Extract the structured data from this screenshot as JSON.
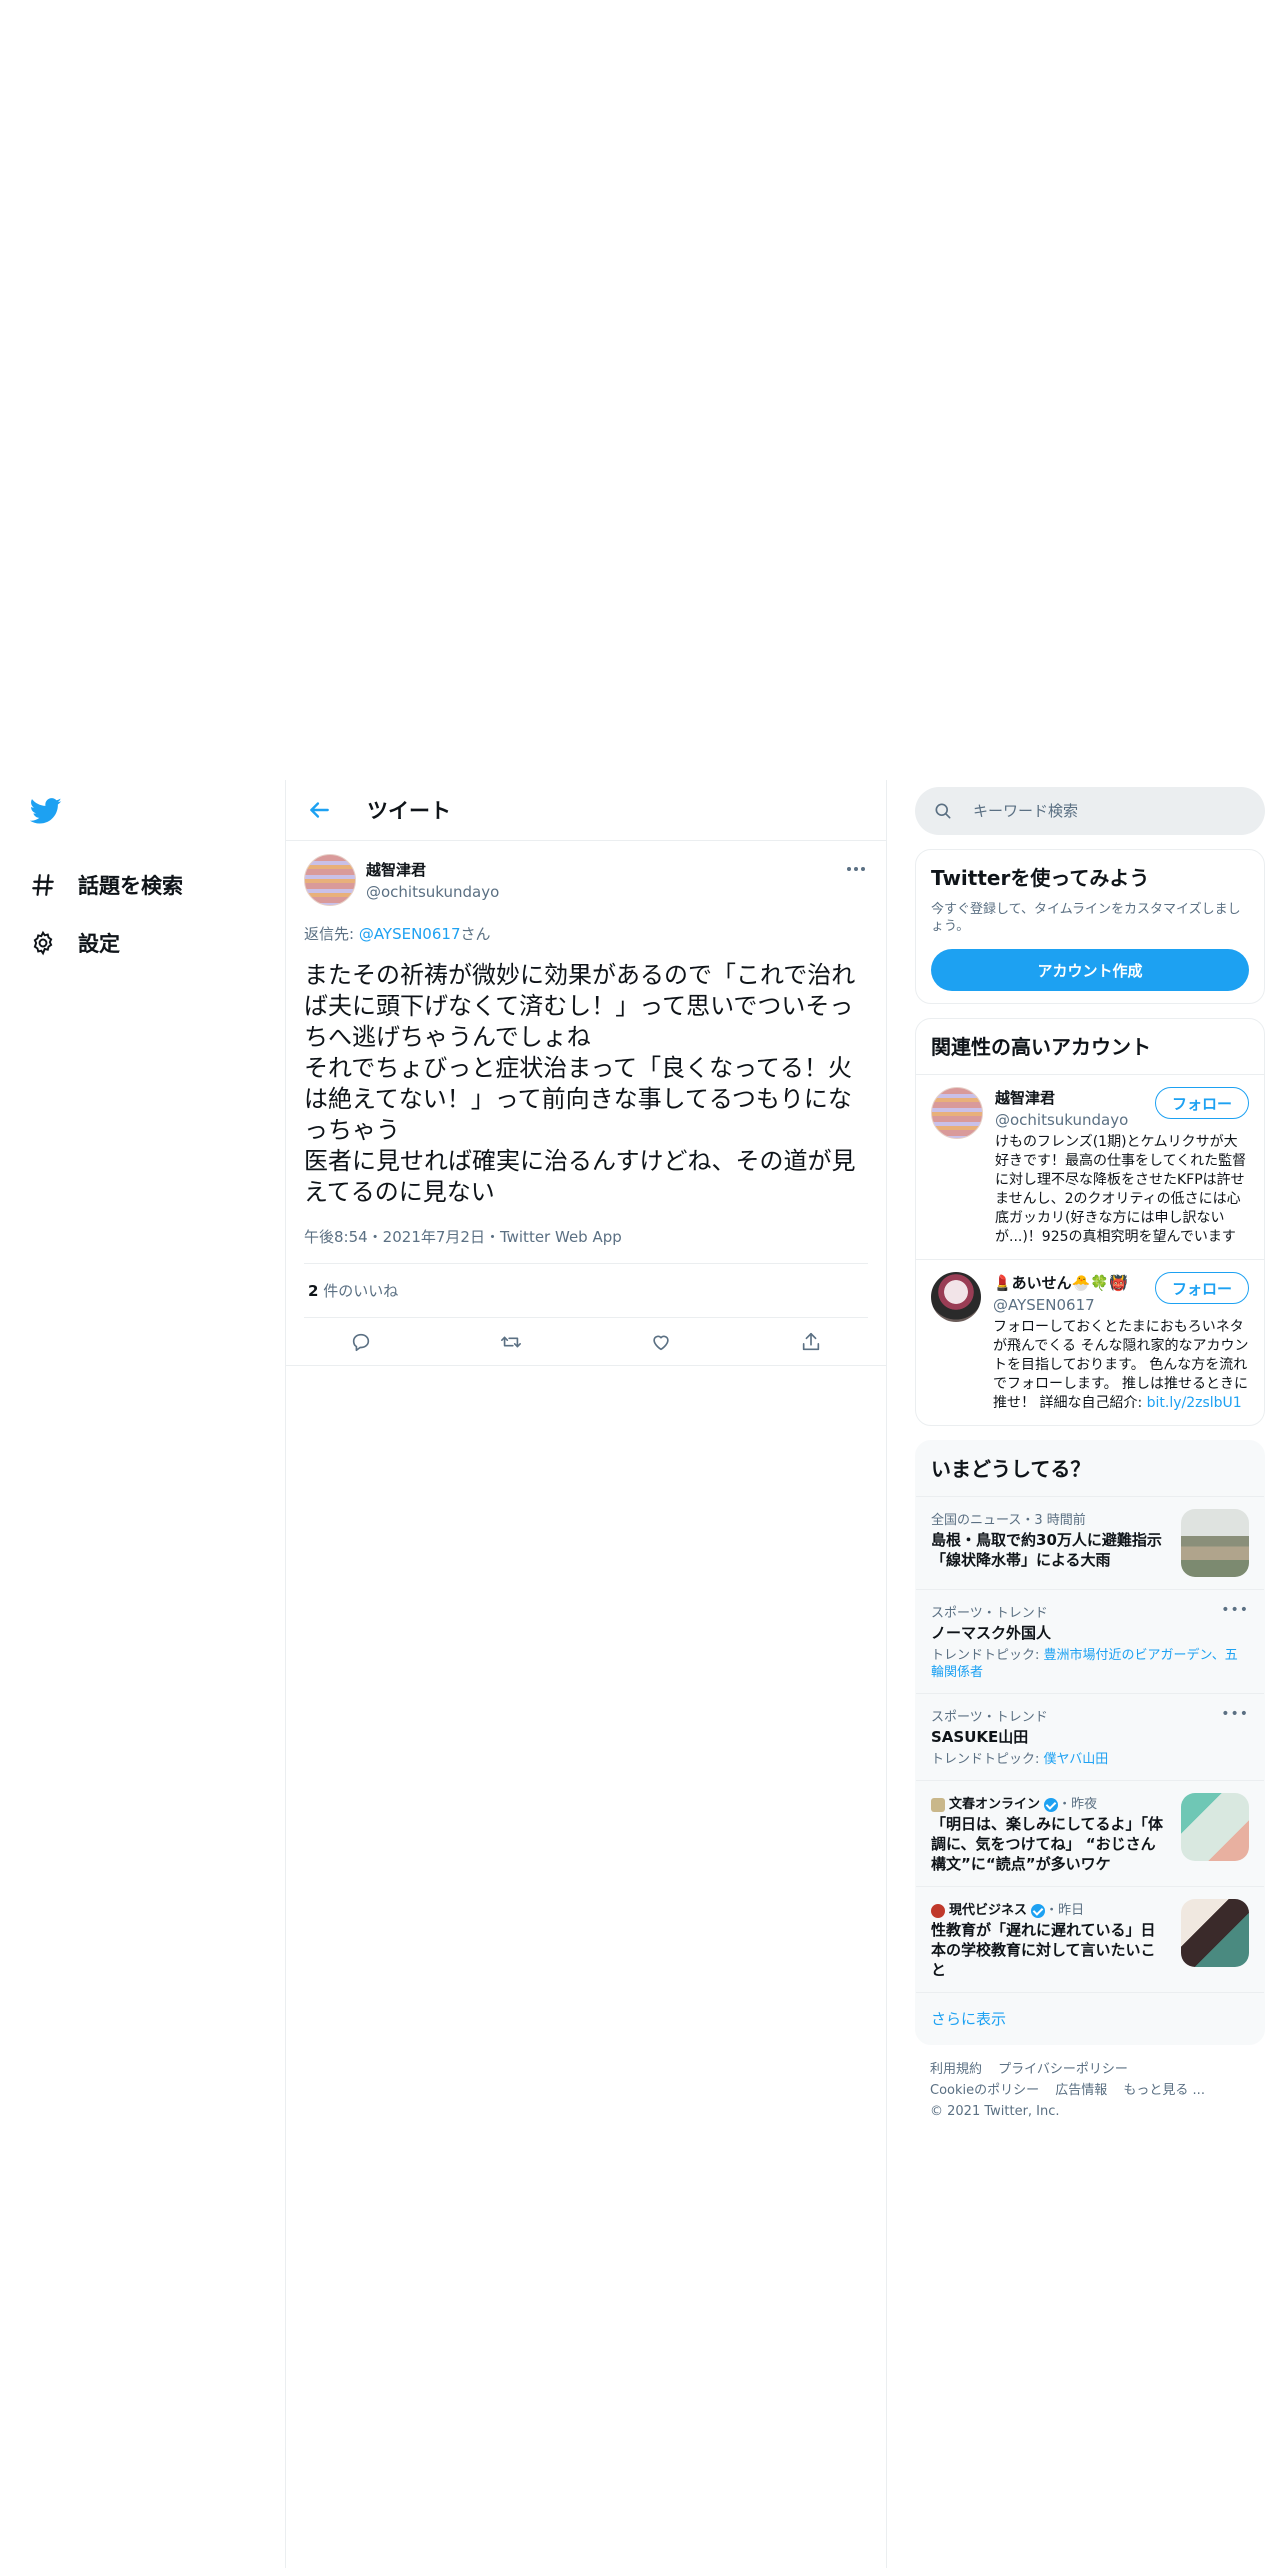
{
  "nav": {
    "items": [
      {
        "label": "話題を検索"
      },
      {
        "label": "設定"
      }
    ]
  },
  "header": {
    "title": "ツイート"
  },
  "tweet": {
    "author_name": "越智津君",
    "author_handle": "@ochitsukundayo",
    "reply_prefix": "返信先: ",
    "reply_to": "@AYSEN0617",
    "reply_suffix": "さん",
    "text": "またその祈祷が微妙に効果があるので「これで治れば夫に頭下げなくて済むし！」って思いでついそっちへ逃げちゃうんでしょね\nそれでちょびっと症状治まって「良くなってる！火は絶えてない！」って前向きな事してるつもりになっちゃう\n医者に見せれば確実に治るんすけどね、その道が見えてるのに見ない",
    "meta": "午後8:54・2021年7月2日・Twitter Web App",
    "likes_count": "2",
    "likes_label": " 件のいいね"
  },
  "search": {
    "placeholder": "キーワード検索"
  },
  "signup": {
    "title": "Twitterを使ってみよう",
    "desc": "今すぐ登録して、タイムラインをカスタマイズしましょう。",
    "button": "アカウント作成"
  },
  "relevant": {
    "title": "関連性の高いアカウント",
    "follow_label": "フォロー",
    "accounts": [
      {
        "name": "越智津君",
        "handle": "@ochitsukundayo",
        "bio": "けものフレンズ(1期)とケムリクサが大好きです！最高の仕事をしてくれた監督に対し理不尽な降板をさせたKFPは許せませんし、2のクオリティの低さには心底ガッカリ(好きな方には申し訳ないが...)！925の真相究明を望んでいます"
      },
      {
        "name": "💄あいせん🐣🍀👹",
        "handle": "@AYSEN0617",
        "bio": "フォローしておくとたまにおもろいネタが飛んでくる そんな隠れ家的なアカウントを目指しております。 色んな方を流れでフォローします。 推しは推せるときに推せ！ 詳細な自己紹介: ",
        "link": "bit.ly/2zslbU1"
      }
    ]
  },
  "trends": {
    "title": "いまどうしてる？",
    "items": [
      {
        "meta": "全国のニュース・3 時間前",
        "title": "島根・鳥取で約30万人に避難指示「線状降水帯」による大雨"
      },
      {
        "meta": "スポーツ・トレンド",
        "title": "ノーマスク外国人",
        "topic_label": "トレンドトピック: ",
        "topic": "豊洲市場付近のビアガーデン、五輪関係者"
      },
      {
        "meta": "スポーツ・トレンド",
        "title": "SASUKE山田",
        "topic_label": "トレンドトピック: ",
        "topic": "僕ヤバ山田"
      },
      {
        "source": "文春オンライン",
        "time": "・昨夜",
        "title": "「明日は、楽しみにしてるよ」「体調に、気をつけてね」 “おじさん構文”に“読点”が多いワケ"
      },
      {
        "source": "現代ビジネス",
        "time": "・昨日",
        "title": "性教育が「遅れに遅れている」日本の学校教育に対して言いたいこと"
      }
    ],
    "more": "さらに表示"
  },
  "footer": {
    "links": [
      "利用規約",
      "プライバシーポリシー",
      "Cookieのポリシー",
      "広告情報",
      "もっと見る ..."
    ],
    "copyright": "© 2021 Twitter, Inc."
  },
  "colors": {
    "accent": "#1da1f2",
    "muted": "#5b7083",
    "text": "#0f1419"
  }
}
